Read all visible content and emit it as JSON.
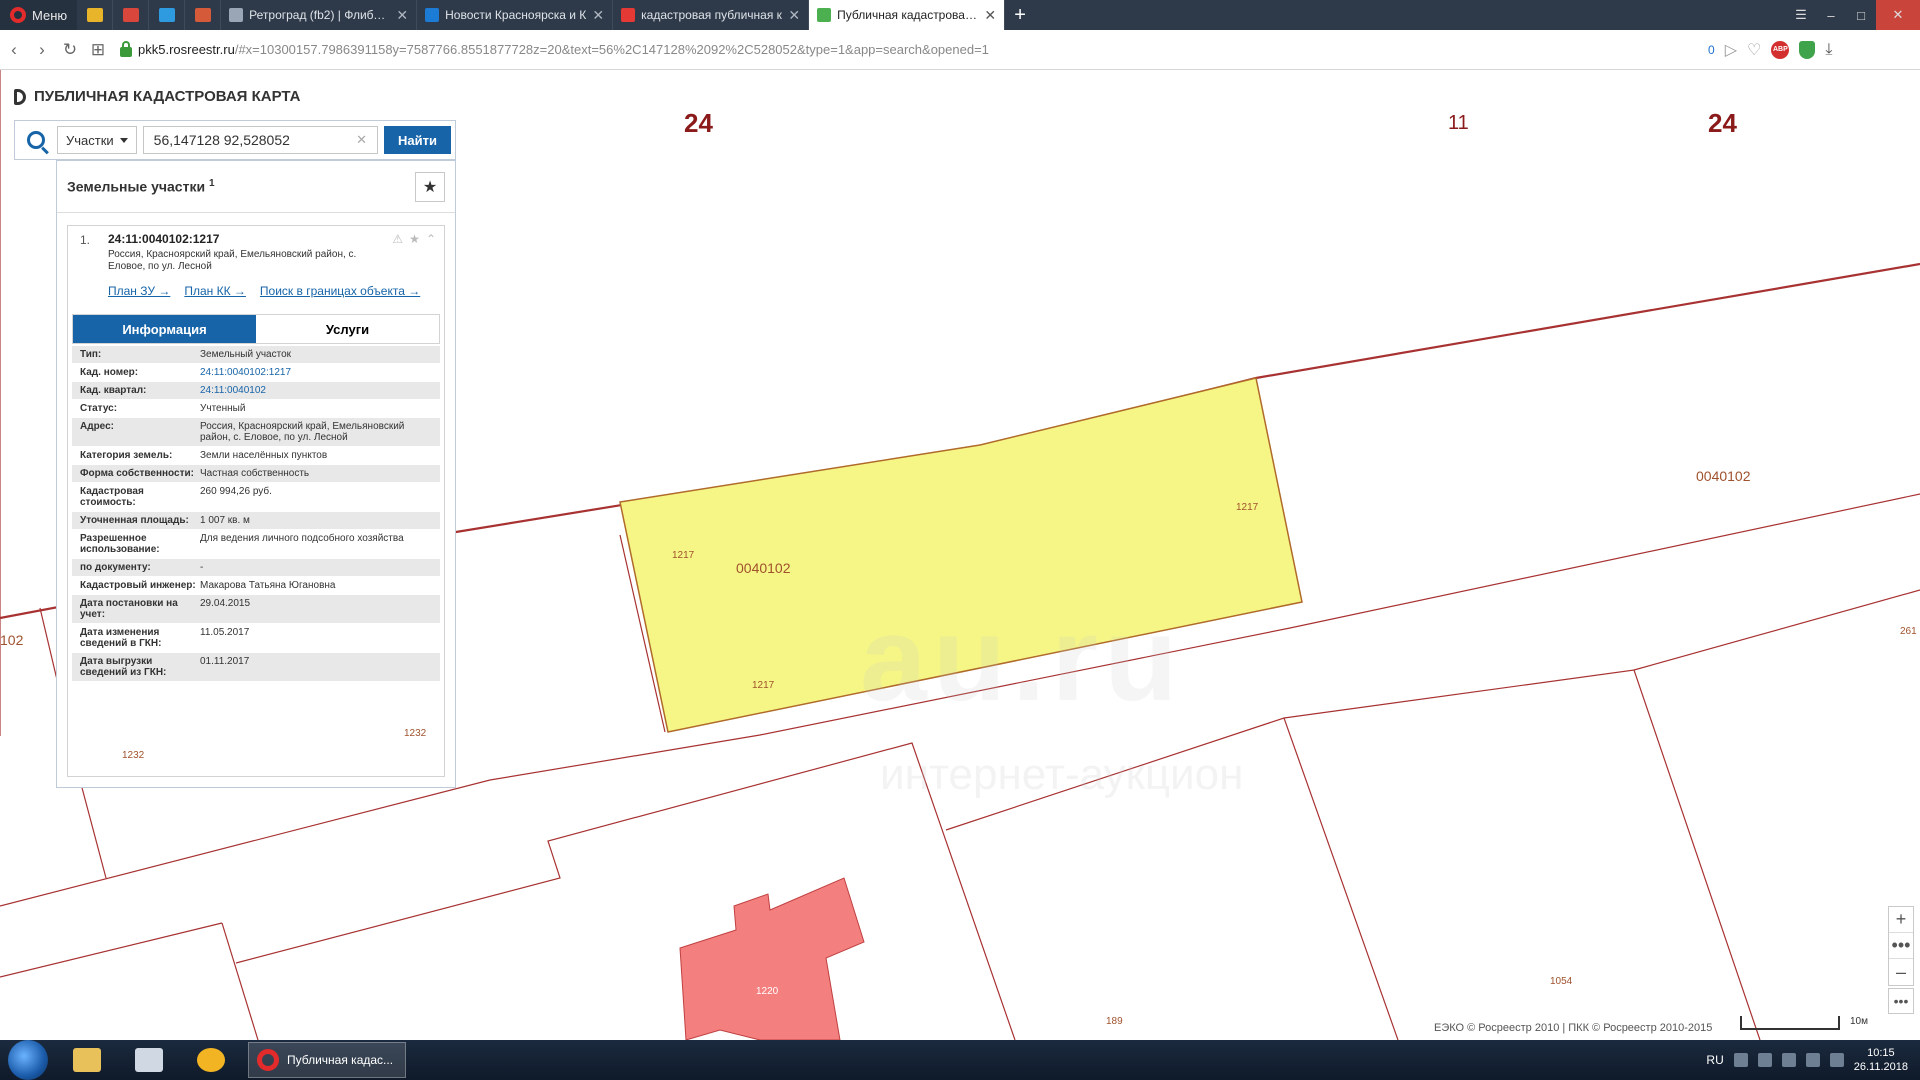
{
  "browser": {
    "menu_label": "Меню",
    "tabs": [
      {
        "title": "Ретроград (fb2) | Флибуста",
        "fav_color": "#9aa6b5"
      },
      {
        "title": "Новости Красноярска и К",
        "fav_color": "#1c7bd4"
      },
      {
        "title": "кадастровая публичная к",
        "fav_color": "#e53935"
      },
      {
        "title": "Публичная кадастровая к",
        "fav_color": "#4caf50"
      }
    ],
    "url_domain": "pkk5.rosreestr.ru",
    "url_rest": "/#x=10300157.7986391158y=7587766.8551877728z=20&text=56%2C147128%2092%2C528052&type=1&app=search&opened=1",
    "badge": "0"
  },
  "app": {
    "title": "ПУБЛИЧНАЯ КАДАСТРОВАЯ КАРТА",
    "search": {
      "type_label": "Участки",
      "query": "56,147128 92,528052",
      "find_label": "Найти"
    },
    "panel": {
      "heading": "Земельные участки",
      "count": "1",
      "item": {
        "num": "1.",
        "cad_number": "24:11:0040102:1217",
        "address": "Россия, Красноярский край, Емельяновский район, с. Еловое, по ул. Лесной",
        "links": [
          "План ЗУ →",
          "План КК →",
          "Поиск в границах объекта →"
        ],
        "tabs": [
          "Информация",
          "Услуги"
        ],
        "rows": [
          {
            "k": "Тип:",
            "v": "Земельный участок"
          },
          {
            "k": "Кад. номер:",
            "v": "24:11:0040102:1217",
            "link": true
          },
          {
            "k": "Кад. квартал:",
            "v": "24:11:0040102",
            "link": true
          },
          {
            "k": "Статус:",
            "v": "Учтенный"
          },
          {
            "k": "Адрес:",
            "v": "Россия, Красноярский край, Емельяновский район, с. Еловое, по ул. Лесной"
          },
          {
            "k": "Категория земель:",
            "v": "Земли населённых пунктов"
          },
          {
            "k": "Форма собственности:",
            "v": "Частная собственность"
          },
          {
            "k": "Кадастровая стоимость:",
            "v": "260 994,26 руб."
          },
          {
            "k": "Уточненная площадь:",
            "v": "1 007 кв. м"
          },
          {
            "k": "Разрешенное использование:",
            "v": "Для ведения личного подсобного хозяйства"
          },
          {
            "k": "по документу:",
            "v": "-"
          },
          {
            "k": "Кадастровый инженер:",
            "v": "Макарова Татьяна Югановна"
          },
          {
            "k": "Дата постановки на учет:",
            "v": "29.04.2015"
          },
          {
            "k": "Дата изменения сведений в ГКН:",
            "v": "11.05.2017"
          },
          {
            "k": "Дата выгрузки сведений из ГКН:",
            "v": "01.11.2017"
          }
        ]
      }
    }
  },
  "map": {
    "region_labels": [
      "24",
      "11",
      "24"
    ],
    "quarter_labels": [
      "0040102",
      "0040102",
      "102",
      "261"
    ],
    "parcel_labels": [
      "1217",
      "1217",
      "1217",
      "1232",
      "1232",
      "1220",
      "1054",
      "189"
    ],
    "watermark": "au.ru",
    "watermark_sub": "интернет-аукцион",
    "copyright": "ЕЭКО © Росреестр 2010 | ПКК © Росреестр 2010-2015",
    "scale_label": "10м",
    "colors": {
      "selected_fill": "#f6f687",
      "building_fill": "#f47f7f",
      "boundary": "#a83232"
    }
  },
  "taskbar": {
    "task_label": "Публичная кадас...",
    "lang": "RU",
    "time": "10:15",
    "date": "26.11.2018"
  }
}
